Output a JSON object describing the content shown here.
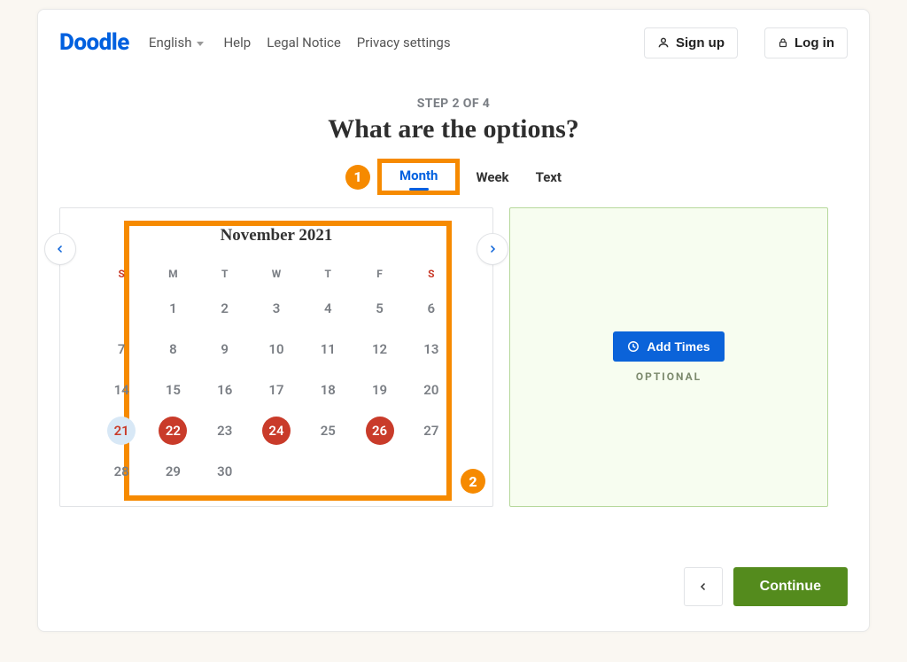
{
  "brand": "Doodle",
  "header": {
    "language": "English",
    "links": [
      "Help",
      "Legal Notice",
      "Privacy settings"
    ],
    "signup": "Sign up",
    "login": "Log in"
  },
  "step_label": "STEP 2 OF 4",
  "title": "What are the options?",
  "tabs": {
    "month": "Month",
    "week": "Week",
    "text": "Text"
  },
  "calendar": {
    "title": "November 2021",
    "dow": [
      "S",
      "M",
      "T",
      "W",
      "T",
      "F",
      "S"
    ],
    "weeks": [
      [
        {
          "v": ""
        },
        {
          "v": "1",
          "past": true
        },
        {
          "v": "2",
          "past": true
        },
        {
          "v": "3",
          "past": true
        },
        {
          "v": "4",
          "past": true
        },
        {
          "v": "5",
          "past": true
        },
        {
          "v": "6",
          "past": true,
          "we": true
        }
      ],
      [
        {
          "v": "7",
          "past": true,
          "we": true
        },
        {
          "v": "8",
          "past": true
        },
        {
          "v": "9",
          "past": true
        },
        {
          "v": "10",
          "past": true
        },
        {
          "v": "11",
          "past": true
        },
        {
          "v": "12",
          "past": true
        },
        {
          "v": "13",
          "past": true,
          "we": true
        }
      ],
      [
        {
          "v": "14",
          "past": true,
          "we": true
        },
        {
          "v": "15",
          "past": true
        },
        {
          "v": "16",
          "past": true
        },
        {
          "v": "17",
          "past": true
        },
        {
          "v": "18",
          "past": true
        },
        {
          "v": "19",
          "past": true
        },
        {
          "v": "20",
          "past": true,
          "we": true
        }
      ],
      [
        {
          "v": "21",
          "today": true,
          "we": true
        },
        {
          "v": "22",
          "sel": true
        },
        {
          "v": "23"
        },
        {
          "v": "24",
          "sel": true
        },
        {
          "v": "25"
        },
        {
          "v": "26",
          "sel": true
        },
        {
          "v": "27",
          "we": true
        }
      ],
      [
        {
          "v": "28",
          "we": true
        },
        {
          "v": "29"
        },
        {
          "v": "30"
        },
        {
          "v": ""
        },
        {
          "v": ""
        },
        {
          "v": ""
        },
        {
          "v": ""
        }
      ]
    ]
  },
  "times": {
    "button": "Add Times",
    "optional": "OPTIONAL"
  },
  "footer": {
    "continue": "Continue"
  },
  "annotations": {
    "one": "1",
    "two": "2"
  }
}
